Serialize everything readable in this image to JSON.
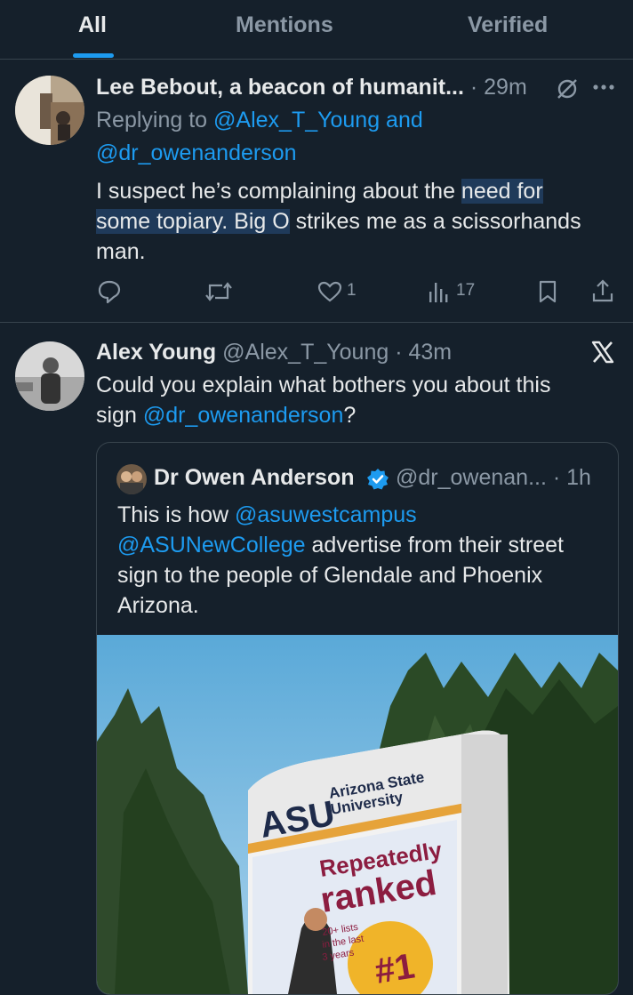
{
  "tabs": [
    {
      "label": "All"
    },
    {
      "label": "Mentions"
    },
    {
      "label": "Verified"
    }
  ],
  "reply": {
    "author": "Lee Bebout, a beacon of humanit...",
    "time": "29m",
    "replying_prefix": "Replying to",
    "replying_to_1": "@Alex_T_Young and",
    "replying_to_2": "@dr_owenanderson",
    "text_1a": "I suspect he’s complaining about the",
    "text_1b": "need for",
    "text_2a": "some topiary. Big O",
    "text_2b": "strikes me as a scissorhands",
    "text_3": "man.",
    "likes": "1",
    "views": "17"
  },
  "tweet": {
    "author": "Alex Young",
    "handle": "@Alex_T_Young",
    "time": "43m",
    "text_1": "Could you explain what bothers you about this",
    "text_2a": "sign",
    "text_2b": "@dr_owenanderson",
    "text_2c": "?"
  },
  "quote": {
    "author": "Dr Owen Anderson",
    "handle": "@dr_owenan...",
    "time": "1h",
    "text_1a": "This is how",
    "text_1b": "@asuwestcampus",
    "text_2a": "@ASUNewCollege",
    "text_2b": "advertise from their street",
    "text_3": "sign to the people of Glendale and Phoenix",
    "text_4": "Arizona."
  },
  "sign": {
    "logo": "ASU",
    "uni_line1": "Arizona State",
    "uni_line2": "University",
    "headline1": "Repeatedly",
    "headline2": "ranked",
    "small1": "20+ lists",
    "small2": "in the last",
    "small3": "3 years",
    "badge": "#1"
  },
  "colors": {
    "background": "#15202b",
    "accent": "#1d9bf0",
    "muted": "#8b98a5",
    "verified": "#1d9bf0"
  }
}
